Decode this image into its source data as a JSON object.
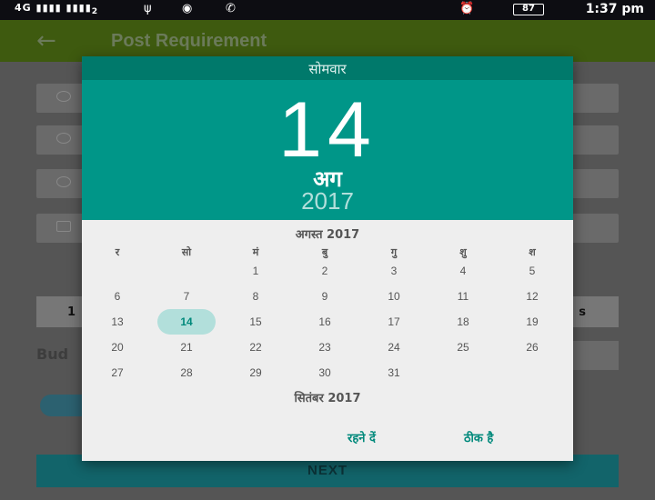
{
  "status": {
    "signal_left": "4G",
    "sim_sub": "2",
    "battery": "87",
    "time": "1:37 pm"
  },
  "appbar": {
    "title": "Post Requirement"
  },
  "background": {
    "btn_left": "1",
    "btn_right": "s",
    "label": "Bud",
    "next": "NEXT"
  },
  "dialog": {
    "dayname": "सोमवार",
    "daynum": "14",
    "month": "अग",
    "year": "2017",
    "calendar_title": "अगस्त 2017",
    "weekdays": [
      "र",
      "सो",
      "मं",
      "बु",
      "गु",
      "शु",
      "श"
    ],
    "days": [
      "1",
      "2",
      "3",
      "4",
      "5",
      "6",
      "7",
      "8",
      "9",
      "10",
      "11",
      "12",
      "13",
      "14",
      "15",
      "16",
      "17",
      "18",
      "19",
      "20",
      "21",
      "22",
      "23",
      "24",
      "25",
      "26",
      "27",
      "28",
      "29",
      "30",
      "31"
    ],
    "first_weekday_index": 2,
    "selected_day": "14",
    "next_month_title": "सितंबर 2017",
    "cancel_label": "रहने दें",
    "ok_label": "ठीक है"
  }
}
